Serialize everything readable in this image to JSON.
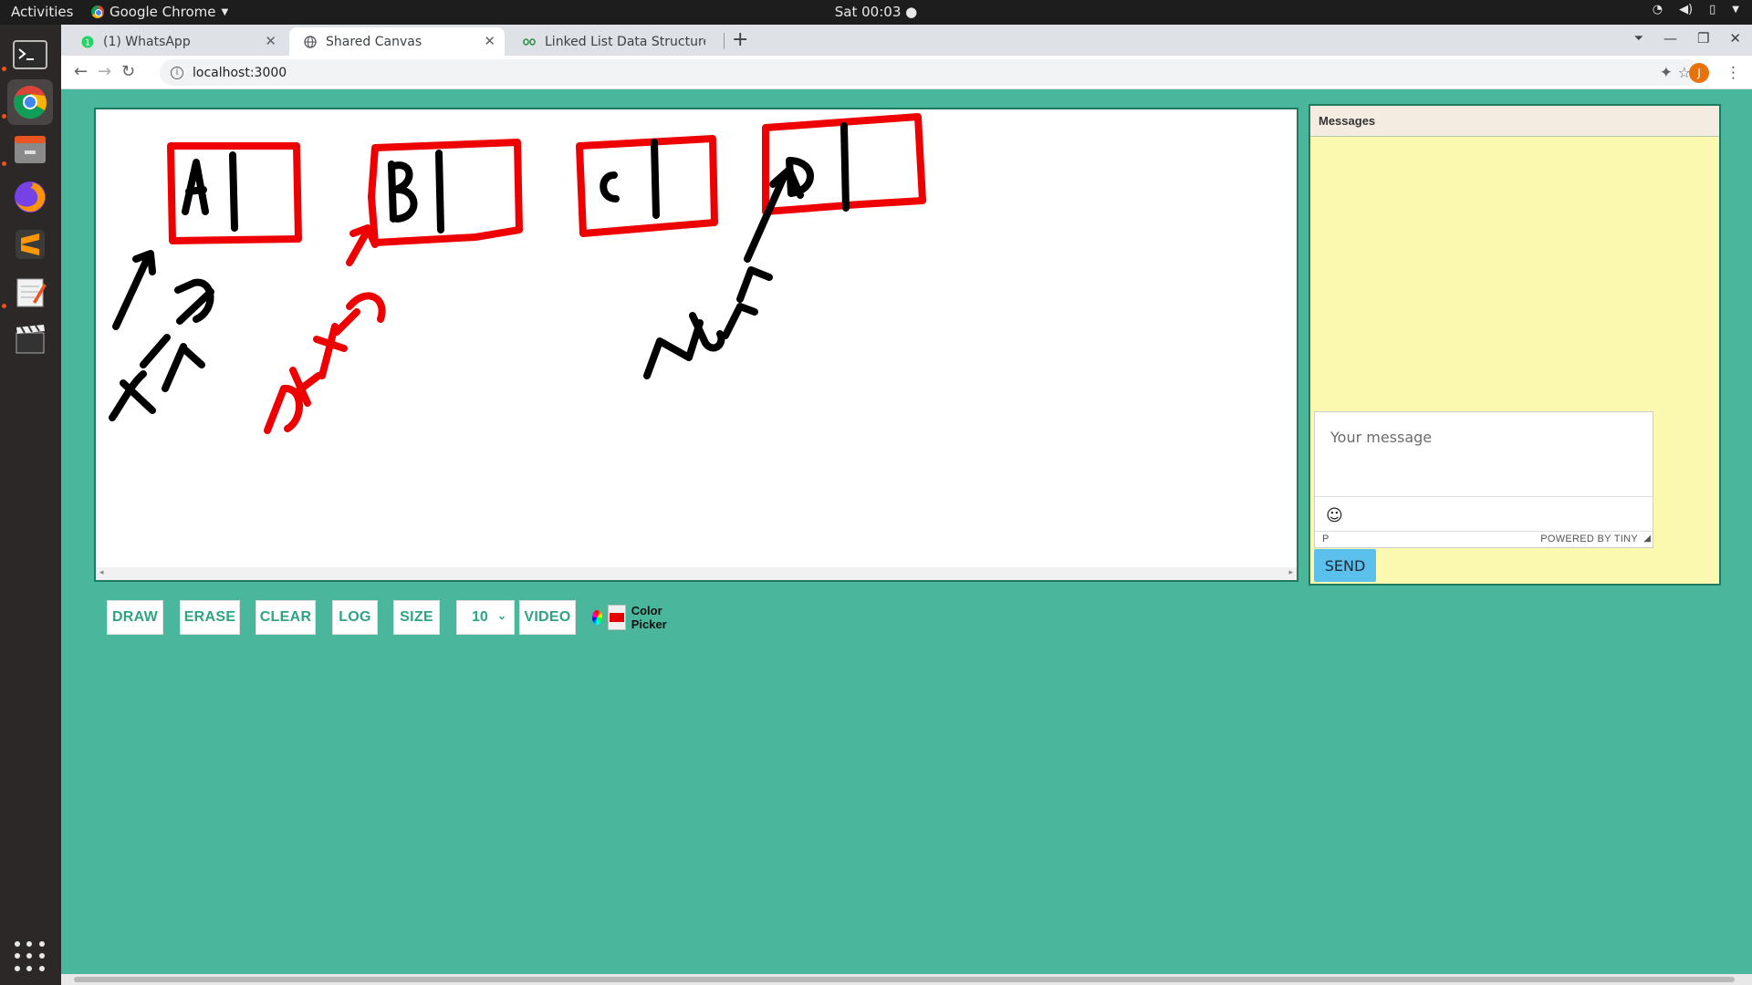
{
  "system": {
    "activities_label": "Activities",
    "app_name": "Google Chrome",
    "clock": "Sat 00:03 ●"
  },
  "tabs": [
    {
      "title": "(1) WhatsApp",
      "icon": "whatsapp-icon"
    },
    {
      "title": "Shared Canvas",
      "icon": "globe-icon"
    },
    {
      "title": "Linked List Data Structure",
      "icon": "gfg-icon"
    }
  ],
  "address_bar": {
    "url": "localhost:3000"
  },
  "profile_initial": "J",
  "canvas": {
    "drawn_labels": [
      "A",
      "B",
      "C",
      "D",
      "HEAD",
      "DATA",
      "NULL"
    ],
    "box_color": "#ee0000",
    "ink_color": "#000000"
  },
  "controls": {
    "draw": "DRAW",
    "erase": "ERASE",
    "clear": "CLEAR",
    "log": "LOG",
    "size": "SIZE",
    "size_value": "10",
    "video": "VIDEO",
    "color_picker_label": "Color Picker",
    "selected_color": "#e50000"
  },
  "chat": {
    "header": "Messages",
    "placeholder": "Your message",
    "status_path": "P",
    "powered_by": "POWERED BY TINY",
    "send": "SEND"
  },
  "colors": {
    "page_bg": "#4ab69c",
    "button_text": "#2fa483",
    "chat_bg": "#fbf8af",
    "send_bg": "#5bc0eb"
  }
}
